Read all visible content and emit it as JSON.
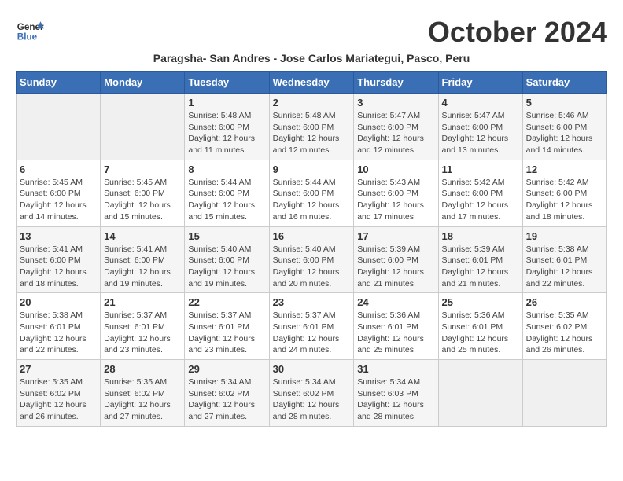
{
  "header": {
    "logo_general": "General",
    "logo_blue": "Blue",
    "month_title": "October 2024",
    "subtitle": "Paragsha- San Andres - Jose Carlos Mariategui, Pasco, Peru"
  },
  "weekdays": [
    "Sunday",
    "Monday",
    "Tuesday",
    "Wednesday",
    "Thursday",
    "Friday",
    "Saturday"
  ],
  "weeks": [
    [
      {
        "day": "",
        "detail": ""
      },
      {
        "day": "",
        "detail": ""
      },
      {
        "day": "1",
        "detail": "Sunrise: 5:48 AM\nSunset: 6:00 PM\nDaylight: 12 hours and 11 minutes."
      },
      {
        "day": "2",
        "detail": "Sunrise: 5:48 AM\nSunset: 6:00 PM\nDaylight: 12 hours and 12 minutes."
      },
      {
        "day": "3",
        "detail": "Sunrise: 5:47 AM\nSunset: 6:00 PM\nDaylight: 12 hours and 12 minutes."
      },
      {
        "day": "4",
        "detail": "Sunrise: 5:47 AM\nSunset: 6:00 PM\nDaylight: 12 hours and 13 minutes."
      },
      {
        "day": "5",
        "detail": "Sunrise: 5:46 AM\nSunset: 6:00 PM\nDaylight: 12 hours and 14 minutes."
      }
    ],
    [
      {
        "day": "6",
        "detail": "Sunrise: 5:45 AM\nSunset: 6:00 PM\nDaylight: 12 hours and 14 minutes."
      },
      {
        "day": "7",
        "detail": "Sunrise: 5:45 AM\nSunset: 6:00 PM\nDaylight: 12 hours and 15 minutes."
      },
      {
        "day": "8",
        "detail": "Sunrise: 5:44 AM\nSunset: 6:00 PM\nDaylight: 12 hours and 15 minutes."
      },
      {
        "day": "9",
        "detail": "Sunrise: 5:44 AM\nSunset: 6:00 PM\nDaylight: 12 hours and 16 minutes."
      },
      {
        "day": "10",
        "detail": "Sunrise: 5:43 AM\nSunset: 6:00 PM\nDaylight: 12 hours and 17 minutes."
      },
      {
        "day": "11",
        "detail": "Sunrise: 5:42 AM\nSunset: 6:00 PM\nDaylight: 12 hours and 17 minutes."
      },
      {
        "day": "12",
        "detail": "Sunrise: 5:42 AM\nSunset: 6:00 PM\nDaylight: 12 hours and 18 minutes."
      }
    ],
    [
      {
        "day": "13",
        "detail": "Sunrise: 5:41 AM\nSunset: 6:00 PM\nDaylight: 12 hours and 18 minutes."
      },
      {
        "day": "14",
        "detail": "Sunrise: 5:41 AM\nSunset: 6:00 PM\nDaylight: 12 hours and 19 minutes."
      },
      {
        "day": "15",
        "detail": "Sunrise: 5:40 AM\nSunset: 6:00 PM\nDaylight: 12 hours and 19 minutes."
      },
      {
        "day": "16",
        "detail": "Sunrise: 5:40 AM\nSunset: 6:00 PM\nDaylight: 12 hours and 20 minutes."
      },
      {
        "day": "17",
        "detail": "Sunrise: 5:39 AM\nSunset: 6:00 PM\nDaylight: 12 hours and 21 minutes."
      },
      {
        "day": "18",
        "detail": "Sunrise: 5:39 AM\nSunset: 6:01 PM\nDaylight: 12 hours and 21 minutes."
      },
      {
        "day": "19",
        "detail": "Sunrise: 5:38 AM\nSunset: 6:01 PM\nDaylight: 12 hours and 22 minutes."
      }
    ],
    [
      {
        "day": "20",
        "detail": "Sunrise: 5:38 AM\nSunset: 6:01 PM\nDaylight: 12 hours and 22 minutes."
      },
      {
        "day": "21",
        "detail": "Sunrise: 5:37 AM\nSunset: 6:01 PM\nDaylight: 12 hours and 23 minutes."
      },
      {
        "day": "22",
        "detail": "Sunrise: 5:37 AM\nSunset: 6:01 PM\nDaylight: 12 hours and 23 minutes."
      },
      {
        "day": "23",
        "detail": "Sunrise: 5:37 AM\nSunset: 6:01 PM\nDaylight: 12 hours and 24 minutes."
      },
      {
        "day": "24",
        "detail": "Sunrise: 5:36 AM\nSunset: 6:01 PM\nDaylight: 12 hours and 25 minutes."
      },
      {
        "day": "25",
        "detail": "Sunrise: 5:36 AM\nSunset: 6:01 PM\nDaylight: 12 hours and 25 minutes."
      },
      {
        "day": "26",
        "detail": "Sunrise: 5:35 AM\nSunset: 6:02 PM\nDaylight: 12 hours and 26 minutes."
      }
    ],
    [
      {
        "day": "27",
        "detail": "Sunrise: 5:35 AM\nSunset: 6:02 PM\nDaylight: 12 hours and 26 minutes."
      },
      {
        "day": "28",
        "detail": "Sunrise: 5:35 AM\nSunset: 6:02 PM\nDaylight: 12 hours and 27 minutes."
      },
      {
        "day": "29",
        "detail": "Sunrise: 5:34 AM\nSunset: 6:02 PM\nDaylight: 12 hours and 27 minutes."
      },
      {
        "day": "30",
        "detail": "Sunrise: 5:34 AM\nSunset: 6:02 PM\nDaylight: 12 hours and 28 minutes."
      },
      {
        "day": "31",
        "detail": "Sunrise: 5:34 AM\nSunset: 6:03 PM\nDaylight: 12 hours and 28 minutes."
      },
      {
        "day": "",
        "detail": ""
      },
      {
        "day": "",
        "detail": ""
      }
    ]
  ]
}
